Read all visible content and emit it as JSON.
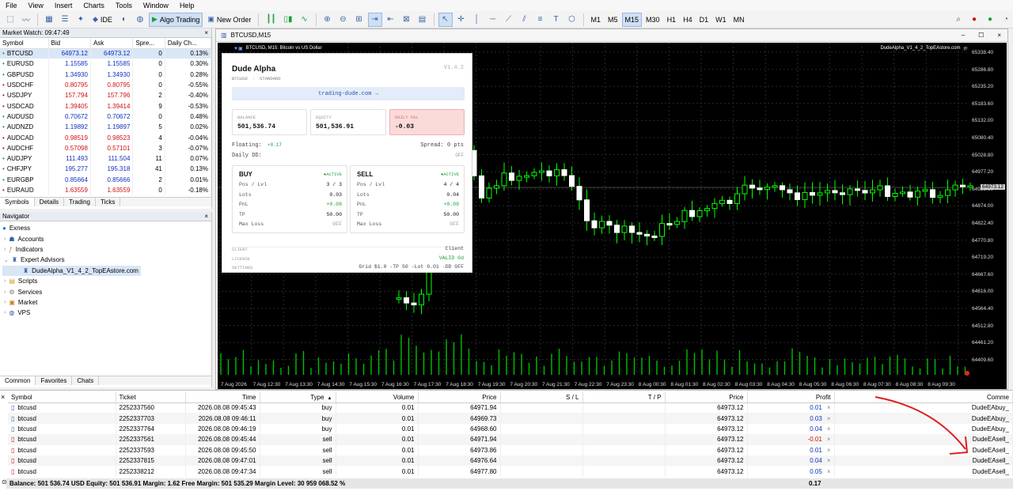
{
  "menu": [
    "File",
    "View",
    "Insert",
    "Charts",
    "Tools",
    "Window",
    "Help"
  ],
  "toolbar": {
    "ide": "IDE",
    "algo": "Algo Trading",
    "new_order": "New Order",
    "periods": [
      "M1",
      "M5",
      "M15",
      "M30",
      "H1",
      "H4",
      "D1",
      "W1",
      "MN"
    ],
    "active_period": "M15"
  },
  "market_watch": {
    "title": "Market Watch: 09:47:49",
    "columns": [
      "Symbol",
      "Bid",
      "Ask",
      "Spre...",
      "Daily Ch..."
    ],
    "rows": [
      [
        "BTCUSD",
        "64973.12",
        "64973.12",
        "0",
        "0.13%"
      ],
      [
        "EURUSD",
        "1.15585",
        "1.15585",
        "0",
        "0.30%"
      ],
      [
        "GBPUSD",
        "1.34930",
        "1.34930",
        "0",
        "0.28%"
      ],
      [
        "USDCHF",
        "0.80795",
        "0.80795",
        "0",
        "-0.55%"
      ],
      [
        "USDJPY",
        "157.794",
        "157.796",
        "2",
        "-0.40%"
      ],
      [
        "USDCAD",
        "1.39405",
        "1.39414",
        "9",
        "-0.53%"
      ],
      [
        "AUDUSD",
        "0.70672",
        "0.70672",
        "0",
        "0.48%"
      ],
      [
        "AUDNZD",
        "1.19892",
        "1.19897",
        "5",
        "0.02%"
      ],
      [
        "AUDCAD",
        "0.98519",
        "0.98523",
        "4",
        "-0.04%"
      ],
      [
        "AUDCHF",
        "0.57098",
        "0.57101",
        "3",
        "-0.07%"
      ],
      [
        "AUDJPY",
        "111.493",
        "111.504",
        "11",
        "0.07%"
      ],
      [
        "CHFJPY",
        "195.277",
        "195.318",
        "41",
        "0.13%"
      ],
      [
        "EURGBP",
        "0.85664",
        "0.85666",
        "2",
        "0.01%"
      ],
      [
        "EURAUD",
        "1.63559",
        "1.63559",
        "0",
        "-0.18%"
      ]
    ],
    "tabs": [
      "Symbols",
      "Details",
      "Trading",
      "Ticks"
    ]
  },
  "navigator": {
    "title": "Navigator",
    "items": [
      "Exness",
      "Accounts",
      "Indicators",
      "Expert Advisors",
      "DudeAlpha_V1_4_2_TopEAstore.com",
      "Scripts",
      "Services",
      "Market",
      "VPS"
    ],
    "tabs": [
      "Common",
      "Favorites",
      "Chats"
    ]
  },
  "chart": {
    "tab": "BTCUSD,M15",
    "subtitle": "BTCUSD, M15: Bitcoin vs US Dollar",
    "ea_label": "DudeAlpha_V1_4_2_TopEAstore.com",
    "prices": [
      "65338.40",
      "65286.80",
      "65235.20",
      "65183.60",
      "65132.00",
      "65080.40",
      "65028.80",
      "64977.20",
      "64925.60",
      "64874.00",
      "64822.40",
      "64770.80",
      "64719.20",
      "64667.60",
      "64616.00",
      "64564.40",
      "64512.80",
      "64461.20",
      "64409.60"
    ],
    "times": [
      "7 Aug 2026",
      "7 Aug 12:30",
      "7 Aug 13:30",
      "7 Aug 14:30",
      "7 Aug 15:30",
      "7 Aug 16:30",
      "7 Aug 17:30",
      "7 Aug 18:30",
      "7 Aug 19:30",
      "7 Aug 20:30",
      "7 Aug 21:30",
      "7 Aug 22:30",
      "7 Aug 23:30",
      "8 Aug 00:30",
      "8 Aug 01:30",
      "8 Aug 02:30",
      "8 Aug 03:30",
      "8 Aug 04:30",
      "8 Aug 05:30",
      "8 Aug 06:30",
      "8 Aug 07:30",
      "8 Aug 08:30",
      "8 Aug 09:30"
    ],
    "current_price": "64973.12"
  },
  "dashboard": {
    "name": "Dude Alpha",
    "version": "V1.4.2",
    "symbol": "BTCUSD",
    "account": "STANDARD",
    "link": "trading-dude.com  →",
    "balance_lbl": "BALANCE",
    "balance": "501,536.74",
    "equity_lbl": "EQUITY",
    "equity": "501,536.91",
    "dpnl_lbl": "DAILY P&L",
    "dpnl": "-0.03",
    "floating_lbl": "Floating:",
    "floating": "+0.17",
    "spread": "Spread: 0 pts",
    "dd_lbl": "Daily DD:",
    "dd": "OFF",
    "buy": {
      "title": "BUY",
      "status": "●ACTIVE",
      "pos": "3 / 3",
      "lots": "0.03",
      "pnl": "+0.08",
      "tp": "50.00",
      "maxloss": "OFF"
    },
    "sell": {
      "title": "SELL",
      "status": "●ACTIVE",
      "pos": "4 / 4",
      "lots": "0.04",
      "pnl": "+0.09",
      "tp": "50.00",
      "maxloss": "OFF"
    },
    "row_labels": [
      "Pos / Lvl",
      "Lots",
      "PnL",
      "TP",
      "Max Loss"
    ],
    "client_lbl": "CLIENT",
    "client": "Client",
    "license_lbl": "LICENSE",
    "license": "VALID 0d",
    "settings_lbl": "SETTINGS",
    "settings": "Grid $1.0 -TP 50 -Lot 0.01 -DD OFF"
  },
  "terminal": {
    "columns": [
      "Symbol",
      "Ticket",
      "Time",
      "Type",
      "Volume",
      "Price",
      "S / L",
      "T / P",
      "Price",
      "Profit",
      "Comme"
    ],
    "rows": [
      [
        "btcusd",
        "2252337560",
        "2026.08.08 09:45:43",
        "buy",
        "0.01",
        "64971.94",
        "",
        "",
        "64973.12",
        "0.01",
        "DudeEAbuy_"
      ],
      [
        "btcusd",
        "2252337703",
        "2026.08.08 09:46:11",
        "buy",
        "0.01",
        "64969.73",
        "",
        "",
        "64973.12",
        "0.03",
        "DudeEAbuy_"
      ],
      [
        "btcusd",
        "2252337764",
        "2026.08.08 09:46:19",
        "buy",
        "0.01",
        "64968.60",
        "",
        "",
        "64973.12",
        "0.04",
        "DudeEAbuy_"
      ],
      [
        "btcusd",
        "2252337561",
        "2026.08.08 09:45:44",
        "sell",
        "0.01",
        "64971.94",
        "",
        "",
        "64973.12",
        "-0.01",
        "DudeEAsell_"
      ],
      [
        "btcusd",
        "2252337593",
        "2026.08.08 09:45:50",
        "sell",
        "0.01",
        "64973.86",
        "",
        "",
        "64973.12",
        "0.01",
        "DudeEAsell_"
      ],
      [
        "btcusd",
        "2252337815",
        "2026.08.08 09:47:01",
        "sell",
        "0.01",
        "64976.64",
        "",
        "",
        "64973.12",
        "0.04",
        "DudeEAsell_"
      ],
      [
        "btcusd",
        "2252338212",
        "2026.08.08 09:47:34",
        "sell",
        "0.01",
        "64977.80",
        "",
        "",
        "64973.12",
        "0.05",
        "DudeEAsell_"
      ]
    ],
    "summary": "Balance: 501 536.74 USD  Equity: 501 536.91  Margin: 1.62  Free Margin: 501 535.29  Margin Level: 30 959 068.52 %",
    "total_profit": "0.17"
  }
}
